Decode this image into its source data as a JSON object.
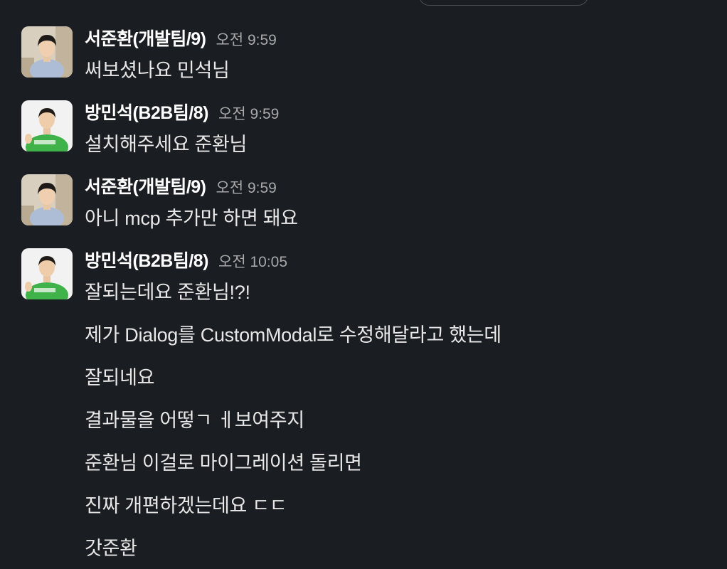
{
  "messages": [
    {
      "author": "서준환(개발팀/9)",
      "time": "오전 9:59",
      "avatar": "avatar-seo",
      "lines": [
        "써보셨나요 민석님"
      ]
    },
    {
      "author": "방민석(B2B팀/8)",
      "time": "오전 9:59",
      "avatar": "avatar-bang",
      "lines": [
        "설치해주세요 준환님"
      ]
    },
    {
      "author": "서준환(개발팀/9)",
      "time": "오전 9:59",
      "avatar": "avatar-seo",
      "lines": [
        "아니 mcp 추가만 하면 돼요"
      ]
    },
    {
      "author": "방민석(B2B팀/8)",
      "time": "오전 10:05",
      "avatar": "avatar-bang",
      "lines": [
        "잘되는데요 준환님!?!",
        "제가 Dialog를 CustomModal로 수정해달라고 했는데",
        "잘되네요",
        "결과물을 어떻ㄱ ㅔ보여주지",
        "준환님 이걸로 마이그레이션 돌리면",
        "진짜 개편하겠는데요 ㄷㄷ",
        "갓준환"
      ]
    }
  ],
  "colors": {
    "background": "#1a1d21",
    "author": "#ffffff",
    "timestamp": "#a8a9ab",
    "body_text": "#e8e8e8",
    "shirt_green": "#3fb24a"
  }
}
